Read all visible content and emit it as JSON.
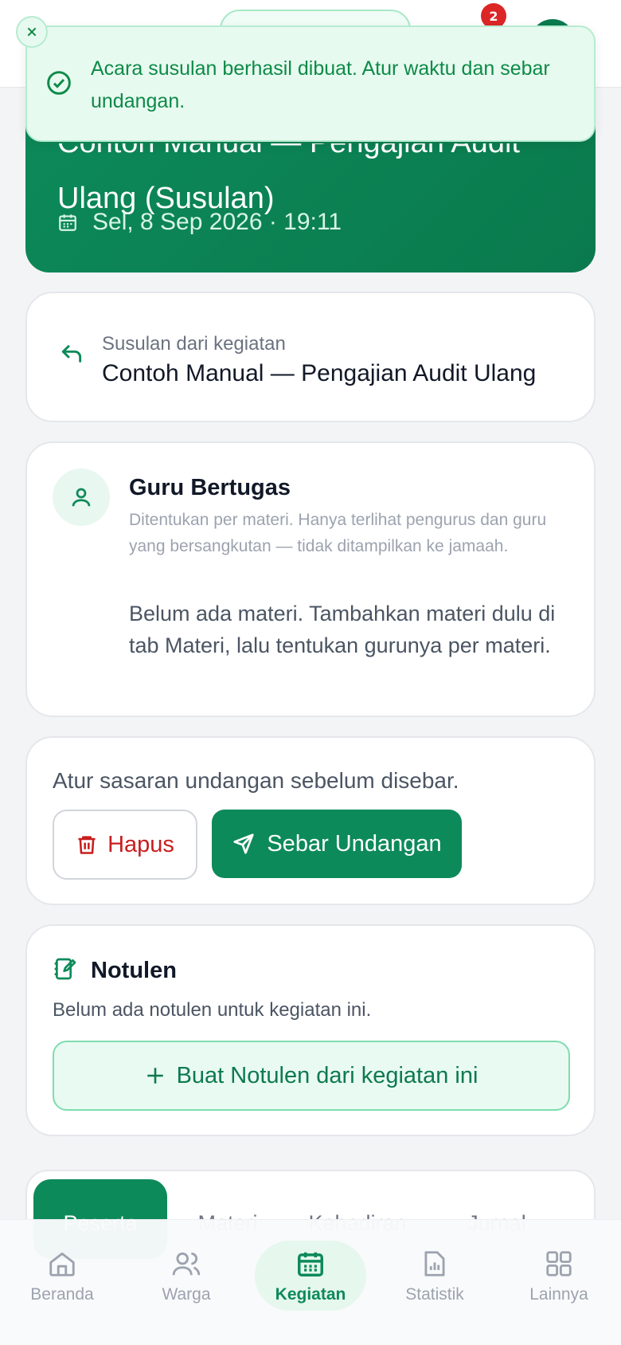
{
  "header": {
    "notification_count": "2"
  },
  "toast": {
    "message": "Acara susulan berhasil dibuat. Atur waktu dan sebar undangan."
  },
  "hero": {
    "title_line1": "Contoh Manual — Pengajian Audit",
    "title_line2": "Ulang (Susulan)",
    "date": "Sel, 8 Sep 2026 · 19:11"
  },
  "origin": {
    "label": "Susulan dari kegiatan",
    "value": "Contoh Manual — Pengajian Audit Ulang"
  },
  "guru": {
    "title": "Guru Bertugas",
    "subtitle": "Ditentukan per materi. Hanya terlihat pengurus dan guru yang bersangkutan — tidak ditampilkan ke jamaah.",
    "empty": "Belum ada materi. Tambahkan materi dulu di tab Materi, lalu tentukan gurunya per materi."
  },
  "actions": {
    "hint": "Atur sasaran undangan sebelum disebar.",
    "delete_label": "Hapus",
    "send_label": "Sebar Undangan"
  },
  "notulen": {
    "title": "Notulen",
    "empty": "Belum ada notulen untuk kegiatan ini.",
    "create_label": "Buat Notulen dari kegiatan ini"
  },
  "tabs": [
    {
      "label": "Peserta",
      "active": true
    },
    {
      "label": "Materi",
      "active": false
    },
    {
      "label": "Kehadiran",
      "active": false
    },
    {
      "label": "Jurnal",
      "active": false
    }
  ],
  "bottom_nav": [
    {
      "label": "Beranda",
      "icon": "home-icon",
      "active": false
    },
    {
      "label": "Warga",
      "icon": "users-icon",
      "active": false
    },
    {
      "label": "Kegiatan",
      "icon": "calendar-icon",
      "active": true
    },
    {
      "label": "Statistik",
      "icon": "chart-icon",
      "active": false
    },
    {
      "label": "Lainnya",
      "icon": "grid-icon",
      "active": false
    }
  ],
  "colors": {
    "primary": "#0d8a5a",
    "danger": "#c81e1e",
    "toast_bg": "#e7faf0"
  }
}
